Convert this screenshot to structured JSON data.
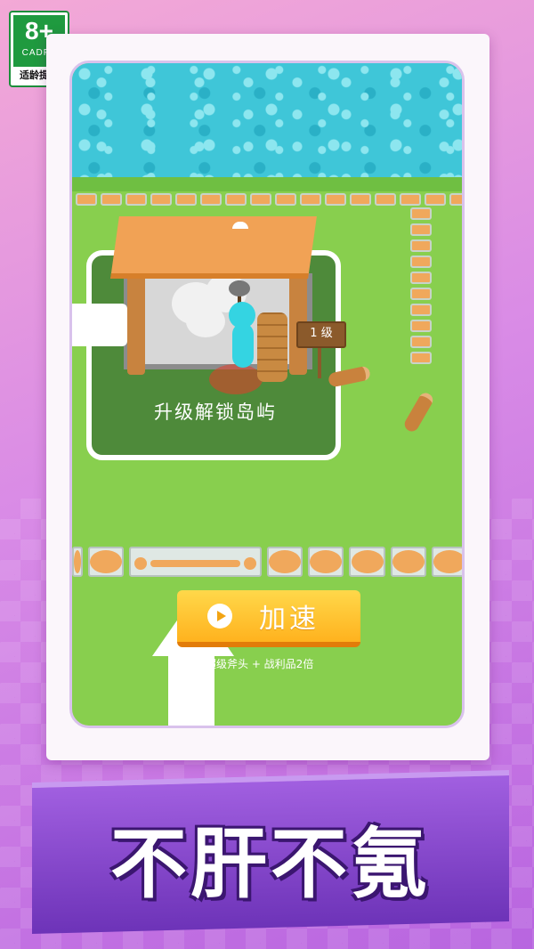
{
  "age_rating": {
    "number": "8+",
    "org": "CADPA",
    "label": "适龄提示"
  },
  "game": {
    "level_sign": "1 级",
    "unlock_text": "升级解锁岛屿",
    "speed_button": {
      "label": "加速",
      "icon": "play-icon",
      "subtitle": "超级斧头 + 战利品2倍"
    }
  },
  "banner": {
    "slogan": "不肝不氪"
  },
  "colors": {
    "grass": "#88cf4e",
    "water": "#3fc6d8",
    "button": "#ffc22e",
    "banner": "#8a47d0"
  }
}
